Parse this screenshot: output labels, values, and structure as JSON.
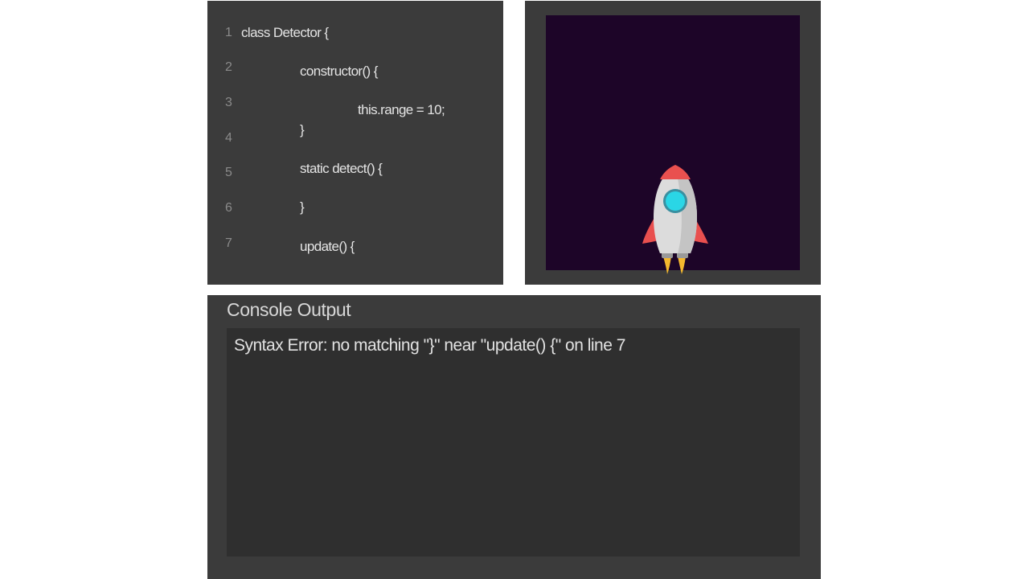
{
  "editor": {
    "lines": [
      {
        "number": "1",
        "text": "class Detector {"
      },
      {
        "number": "2",
        "text": "constructor() {"
      },
      {
        "number": "3",
        "text": "this.range = 10;"
      },
      {
        "number": "4",
        "text": "}"
      },
      {
        "number": "5",
        "text": "static detect() {"
      },
      {
        "number": "6",
        "text": "}"
      },
      {
        "number": "7",
        "text": "update() {"
      }
    ]
  },
  "preview": {
    "background_color": "#1d0528",
    "sprite": "rocket-icon"
  },
  "console": {
    "title": "Console Output",
    "message": "Syntax Error: no matching \"}\" near \"update() {\" on line 7"
  }
}
